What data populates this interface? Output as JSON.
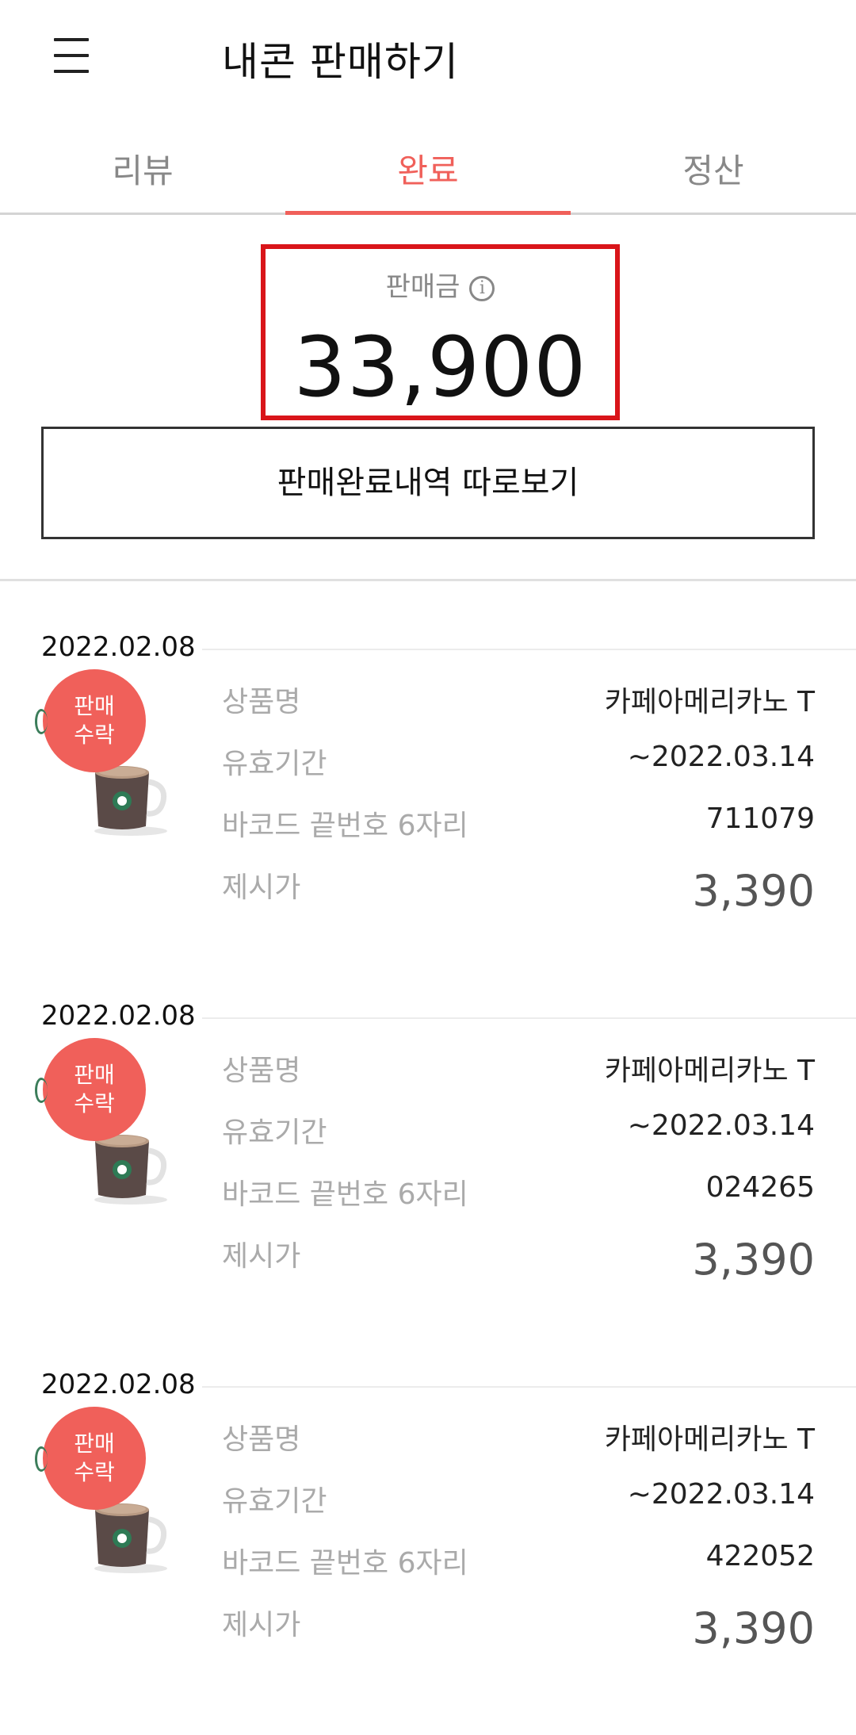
{
  "header": {
    "title": "내콘 판매하기"
  },
  "tabs": [
    {
      "label": "리뷰",
      "active": false
    },
    {
      "label": "완료",
      "active": true
    },
    {
      "label": "정산",
      "active": false
    }
  ],
  "summary": {
    "label": "판매금",
    "amount": "33,900"
  },
  "history_button": "판매완료내역 따로보기",
  "items": [
    {
      "date": "2022.02.08",
      "badge_line1": "판매",
      "badge_line2": "수락",
      "fields": {
        "name_label": "상품명",
        "name_value": "카페아메리카노 T",
        "expiry_label": "유효기간",
        "expiry_value": "~2022.03.14",
        "barcode_label": "바코드 끝번호 6자리",
        "barcode_value": "711079",
        "price_label": "제시가",
        "price_value": "3,390"
      }
    },
    {
      "date": "2022.02.08",
      "badge_line1": "판매",
      "badge_line2": "수락",
      "fields": {
        "name_label": "상품명",
        "name_value": "카페아메리카노 T",
        "expiry_label": "유효기간",
        "expiry_value": "~2022.03.14",
        "barcode_label": "바코드 끝번호 6자리",
        "barcode_value": "024265",
        "price_label": "제시가",
        "price_value": "3,390"
      }
    },
    {
      "date": "2022.02.08",
      "badge_line1": "판매",
      "badge_line2": "수락",
      "fields": {
        "name_label": "상품명",
        "name_value": "카페아메리카노 T",
        "expiry_label": "유효기간",
        "expiry_value": "~2022.03.14",
        "barcode_label": "바코드 끝번호 6자리",
        "barcode_value": "422052",
        "price_label": "제시가",
        "price_value": "3,390"
      }
    }
  ],
  "icons": {
    "menu": "hamburger-menu-icon",
    "info": "info-icon",
    "product": "coffee-mug-icon"
  },
  "colors": {
    "accent": "#f0605a",
    "highlight_box": "#d9151a"
  }
}
